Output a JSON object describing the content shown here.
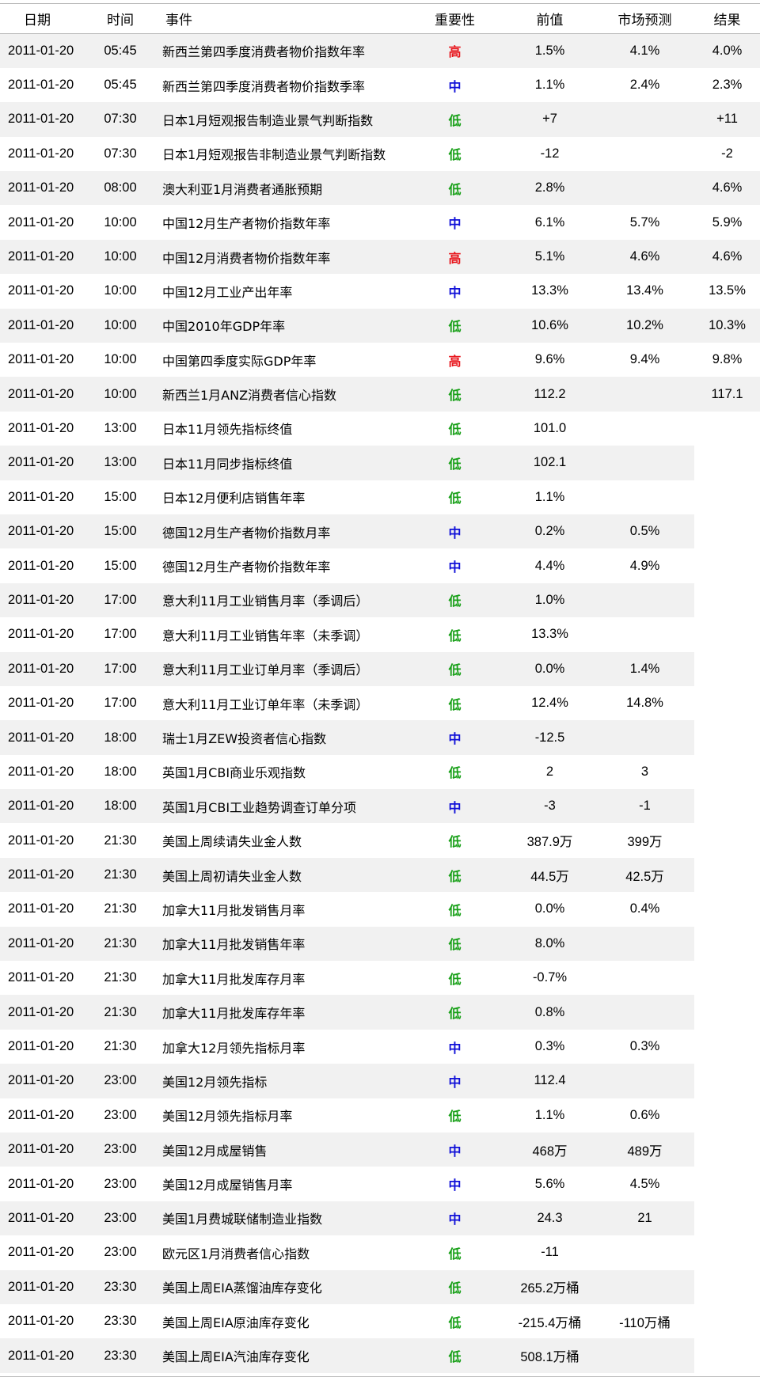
{
  "header": {
    "date": "日期",
    "time": "时间",
    "event": "事件",
    "importance": "重要性",
    "previous": "前值",
    "forecast": "市场预测",
    "actual": "结果"
  },
  "importance_colors": {
    "高": "#e8141b",
    "中": "#1010d8",
    "低": "#18a018"
  },
  "rows": [
    {
      "date": "2011-01-20",
      "time": "05:45",
      "event": "新西兰第四季度消费者物价指数年率",
      "importance": "高",
      "previous": "1.5%",
      "forecast": "4.1%",
      "actual": "4.0%"
    },
    {
      "date": "2011-01-20",
      "time": "05:45",
      "event": "新西兰第四季度消费者物价指数季率",
      "importance": "中",
      "previous": "1.1%",
      "forecast": "2.4%",
      "actual": "2.3%"
    },
    {
      "date": "2011-01-20",
      "time": "07:30",
      "event": "日本1月短观报告制造业景气判断指数",
      "importance": "低",
      "previous": "+7",
      "forecast": "",
      "actual": "+11"
    },
    {
      "date": "2011-01-20",
      "time": "07:30",
      "event": "日本1月短观报告非制造业景气判断指数",
      "importance": "低",
      "previous": "-12",
      "forecast": "",
      "actual": "-2"
    },
    {
      "date": "2011-01-20",
      "time": "08:00",
      "event": "澳大利亚1月消费者通胀预期",
      "importance": "低",
      "previous": "2.8%",
      "forecast": "",
      "actual": "4.6%"
    },
    {
      "date": "2011-01-20",
      "time": "10:00",
      "event": "中国12月生产者物价指数年率",
      "importance": "中",
      "previous": "6.1%",
      "forecast": "5.7%",
      "actual": "5.9%"
    },
    {
      "date": "2011-01-20",
      "time": "10:00",
      "event": "中国12月消费者物价指数年率",
      "importance": "高",
      "previous": "5.1%",
      "forecast": "4.6%",
      "actual": "4.6%"
    },
    {
      "date": "2011-01-20",
      "time": "10:00",
      "event": "中国12月工业产出年率",
      "importance": "中",
      "previous": "13.3%",
      "forecast": "13.4%",
      "actual": "13.5%"
    },
    {
      "date": "2011-01-20",
      "time": "10:00",
      "event": "中国2010年GDP年率",
      "importance": "低",
      "previous": "10.6%",
      "forecast": "10.2%",
      "actual": "10.3%"
    },
    {
      "date": "2011-01-20",
      "time": "10:00",
      "event": "中国第四季度实际GDP年率",
      "importance": "高",
      "previous": "9.6%",
      "forecast": "9.4%",
      "actual": "9.8%"
    },
    {
      "date": "2011-01-20",
      "time": "10:00",
      "event": "新西兰1月ANZ消费者信心指数",
      "importance": "低",
      "previous": "112.2",
      "forecast": "",
      "actual": "117.1"
    },
    {
      "date": "2011-01-20",
      "time": "13:00",
      "event": "日本11月领先指标终值",
      "importance": "低",
      "previous": "101.0",
      "forecast": "",
      "actual": ""
    },
    {
      "date": "2011-01-20",
      "time": "13:00",
      "event": "日本11月同步指标终值",
      "importance": "低",
      "previous": "102.1",
      "forecast": "",
      "actual": ""
    },
    {
      "date": "2011-01-20",
      "time": "15:00",
      "event": "日本12月便利店销售年率",
      "importance": "低",
      "previous": "1.1%",
      "forecast": "",
      "actual": ""
    },
    {
      "date": "2011-01-20",
      "time": "15:00",
      "event": "德国12月生产者物价指数月率",
      "importance": "中",
      "previous": "0.2%",
      "forecast": "0.5%",
      "actual": ""
    },
    {
      "date": "2011-01-20",
      "time": "15:00",
      "event": "德国12月生产者物价指数年率",
      "importance": "中",
      "previous": "4.4%",
      "forecast": "4.9%",
      "actual": ""
    },
    {
      "date": "2011-01-20",
      "time": "17:00",
      "event": "意大利11月工业销售月率（季调后）",
      "importance": "低",
      "previous": "1.0%",
      "forecast": "",
      "actual": ""
    },
    {
      "date": "2011-01-20",
      "time": "17:00",
      "event": "意大利11月工业销售年率（未季调）",
      "importance": "低",
      "previous": "13.3%",
      "forecast": "",
      "actual": ""
    },
    {
      "date": "2011-01-20",
      "time": "17:00",
      "event": "意大利11月工业订单月率（季调后）",
      "importance": "低",
      "previous": "0.0%",
      "forecast": "1.4%",
      "actual": ""
    },
    {
      "date": "2011-01-20",
      "time": "17:00",
      "event": "意大利11月工业订单年率（未季调）",
      "importance": "低",
      "previous": "12.4%",
      "forecast": "14.8%",
      "actual": ""
    },
    {
      "date": "2011-01-20",
      "time": "18:00",
      "event": "瑞士1月ZEW投资者信心指数",
      "importance": "中",
      "previous": "-12.5",
      "forecast": "",
      "actual": ""
    },
    {
      "date": "2011-01-20",
      "time": "18:00",
      "event": "英国1月CBI商业乐观指数",
      "importance": "低",
      "previous": "2",
      "forecast": "3",
      "actual": ""
    },
    {
      "date": "2011-01-20",
      "time": "18:00",
      "event": "英国1月CBI工业趋势调查订单分项",
      "importance": "中",
      "previous": "-3",
      "forecast": "-1",
      "actual": ""
    },
    {
      "date": "2011-01-20",
      "time": "21:30",
      "event": "美国上周续请失业金人数",
      "importance": "低",
      "previous": "387.9万",
      "forecast": "399万",
      "actual": ""
    },
    {
      "date": "2011-01-20",
      "time": "21:30",
      "event": "美国上周初请失业金人数",
      "importance": "低",
      "previous": "44.5万",
      "forecast": "42.5万",
      "actual": ""
    },
    {
      "date": "2011-01-20",
      "time": "21:30",
      "event": "加拿大11月批发销售月率",
      "importance": "低",
      "previous": "0.0%",
      "forecast": "0.4%",
      "actual": ""
    },
    {
      "date": "2011-01-20",
      "time": "21:30",
      "event": "加拿大11月批发销售年率",
      "importance": "低",
      "previous": "8.0%",
      "forecast": "",
      "actual": ""
    },
    {
      "date": "2011-01-20",
      "time": "21:30",
      "event": "加拿大11月批发库存月率",
      "importance": "低",
      "previous": "-0.7%",
      "forecast": "",
      "actual": ""
    },
    {
      "date": "2011-01-20",
      "time": "21:30",
      "event": "加拿大11月批发库存年率",
      "importance": "低",
      "previous": "0.8%",
      "forecast": "",
      "actual": ""
    },
    {
      "date": "2011-01-20",
      "time": "21:30",
      "event": "加拿大12月领先指标月率",
      "importance": "中",
      "previous": "0.3%",
      "forecast": "0.3%",
      "actual": ""
    },
    {
      "date": "2011-01-20",
      "time": "23:00",
      "event": "美国12月领先指标",
      "importance": "中",
      "previous": "112.4",
      "forecast": "",
      "actual": ""
    },
    {
      "date": "2011-01-20",
      "time": "23:00",
      "event": "美国12月领先指标月率",
      "importance": "低",
      "previous": "1.1%",
      "forecast": "0.6%",
      "actual": ""
    },
    {
      "date": "2011-01-20",
      "time": "23:00",
      "event": "美国12月成屋销售",
      "importance": "中",
      "previous": "468万",
      "forecast": "489万",
      "actual": ""
    },
    {
      "date": "2011-01-20",
      "time": "23:00",
      "event": "美国12月成屋销售月率",
      "importance": "中",
      "previous": "5.6%",
      "forecast": "4.5%",
      "actual": ""
    },
    {
      "date": "2011-01-20",
      "time": "23:00",
      "event": "美国1月费城联储制造业指数",
      "importance": "中",
      "previous": "24.3",
      "forecast": "21",
      "actual": ""
    },
    {
      "date": "2011-01-20",
      "time": "23:00",
      "event": "欧元区1月消费者信心指数",
      "importance": "低",
      "previous": "-11",
      "forecast": "",
      "actual": ""
    },
    {
      "date": "2011-01-20",
      "time": "23:30",
      "event": "美国上周EIA蒸馏油库存变化",
      "importance": "低",
      "previous": "265.2万桶",
      "forecast": "",
      "actual": ""
    },
    {
      "date": "2011-01-20",
      "time": "23:30",
      "event": "美国上周EIA原油库存变化",
      "importance": "低",
      "previous": "-215.4万桶",
      "forecast": "-110万桶",
      "actual": ""
    },
    {
      "date": "2011-01-20",
      "time": "23:30",
      "event": "美国上周EIA汽油库存变化",
      "importance": "低",
      "previous": "508.1万桶",
      "forecast": "",
      "actual": ""
    }
  ]
}
